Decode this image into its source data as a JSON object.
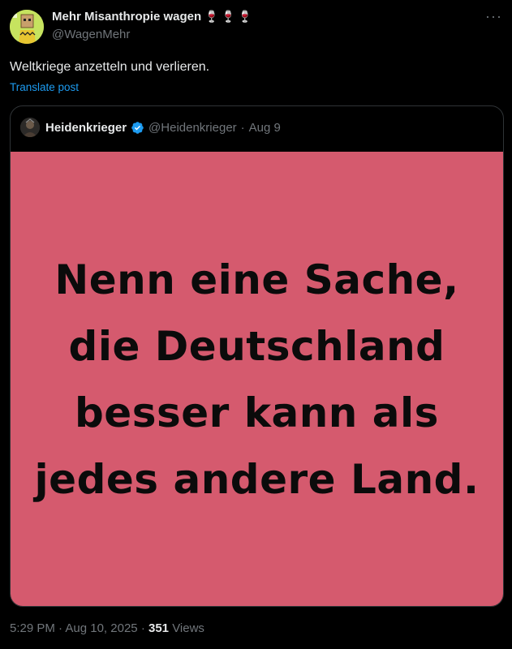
{
  "author": {
    "display_name": "Mehr Misanthropie wagen",
    "emoji": "🍷🍷🍷",
    "handle": "@WagenMehr"
  },
  "more_icon": "more-horizontal-icon",
  "post": {
    "text": "Weltkriege anzetteln und verlieren.",
    "translate_label": "Translate post"
  },
  "quote": {
    "display_name": "Heidenkrieger",
    "verified": true,
    "handle": "@Heidenkrieger",
    "separator": "·",
    "date": "Aug 9",
    "image_text_lines": [
      "Nenn eine Sache,",
      "die Deutschland",
      "besser kann als",
      "jedes andere Land."
    ],
    "image_background": "#d55a6e"
  },
  "footer": {
    "time": "5:29 PM",
    "separator": "·",
    "date": "Aug 10, 2025",
    "views_count": "351",
    "views_label": "Views"
  },
  "colors": {
    "background": "#000000",
    "text_primary": "#e7e9ea",
    "text_secondary": "#71767b",
    "link": "#1d9bf0",
    "verified": "#1d9bf0"
  }
}
